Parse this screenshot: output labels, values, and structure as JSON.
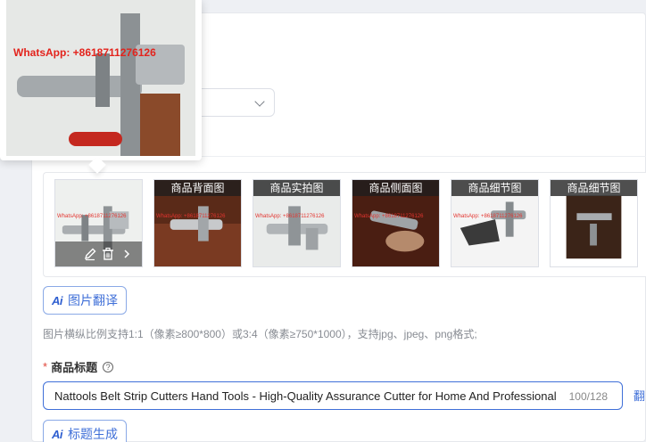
{
  "popup": {
    "watermark": "WhatsApp: +8618711276126"
  },
  "gallery": {
    "thumbs": [
      {
        "tag": "",
        "watermark": "WhatsApp: +8618711276126"
      },
      {
        "tag": "商品背面图",
        "watermark": "WhatsApp: +8618711276126"
      },
      {
        "tag": "商品实拍图",
        "watermark": "WhatsApp: +8618711276126"
      },
      {
        "tag": "商品侧面图",
        "watermark": "WhatsApp: +8618711276126"
      },
      {
        "tag": "商品细节图",
        "watermark": "WhatsApp: +8618711276126"
      },
      {
        "tag": "商品细节图",
        "watermark": ""
      }
    ]
  },
  "buttons": {
    "ai_glyph": "Ai",
    "image_translate": "图片翻译",
    "title_generate": "标题生成"
  },
  "hint": "图片横纵比例支持1:1（像素≥800*800）或3:4（像素≥750*1000），支持jpg、jpeg、png格式;",
  "title_field": {
    "required_mark": "*",
    "label": "商品标题",
    "help": "?",
    "value": "Nattools Belt Strip Cutters Hand Tools - High-Quality Assurance Cutter for Home And Professional Use",
    "count": "100/128"
  },
  "side_link": "翻",
  "colors": {
    "accent": "#3f6fd8",
    "required": "#e0463a",
    "watermark_red": "#e3231c"
  }
}
